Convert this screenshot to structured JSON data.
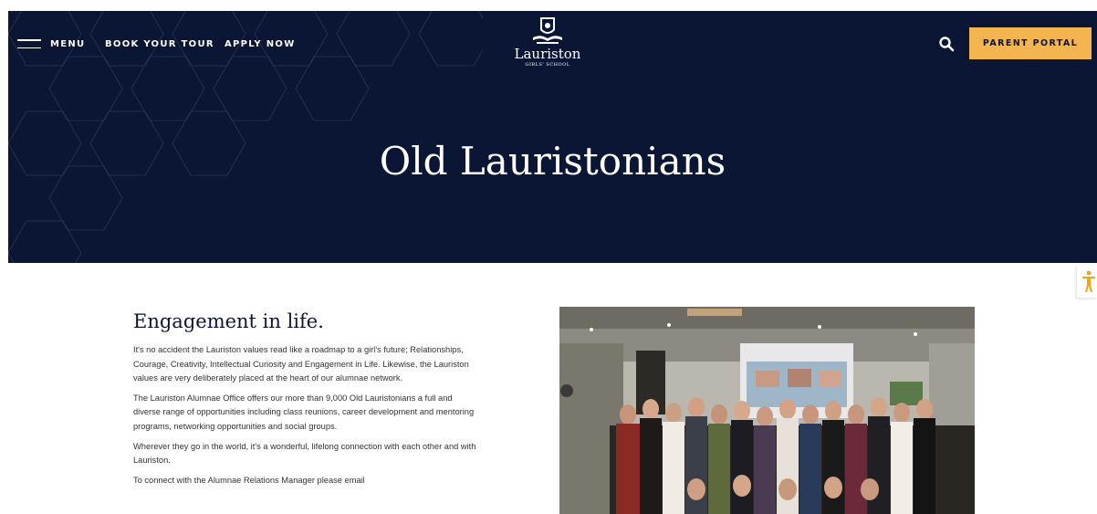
{
  "nav": {
    "menu_label": "MENU",
    "book_tour": "BOOK YOUR TOUR",
    "apply_now": "APPLY NOW",
    "parent_portal": "PARENT PORTAL"
  },
  "logo": {
    "name": "Lauriston",
    "subtitle": "GIRLS' SCHOOL"
  },
  "hero": {
    "title": "Old Lauristonians"
  },
  "content": {
    "heading": "Engagement in life.",
    "paragraphs": [
      "It's no accident the Lauriston values read like a roadmap to a girl's future; Relationships, Courage, Creativity, Intellectual Curiosity and Engagement in Life. Likewise, the Lauriston values are very deliberately placed at the heart of our alumnae network.",
      "The Lauriston Alumnae Office offers our more than 9,000 Old Lauristonians a full and diverse range of opportunities including class reunions, career development and mentoring programs, networking opportunities and social groups.",
      "Wherever they go in the world, it's a wonderful, lifelong connection with each other and with Lauriston.",
      "To connect with the Alumnae Relations Manager please email"
    ]
  },
  "icons": {
    "menu": "hamburger-icon",
    "search": "search-icon",
    "accessibility": "accessibility-icon",
    "crest": "school-crest-icon"
  },
  "colors": {
    "navy": "#0b1534",
    "accent": "#f4b450",
    "text": "#333333"
  }
}
